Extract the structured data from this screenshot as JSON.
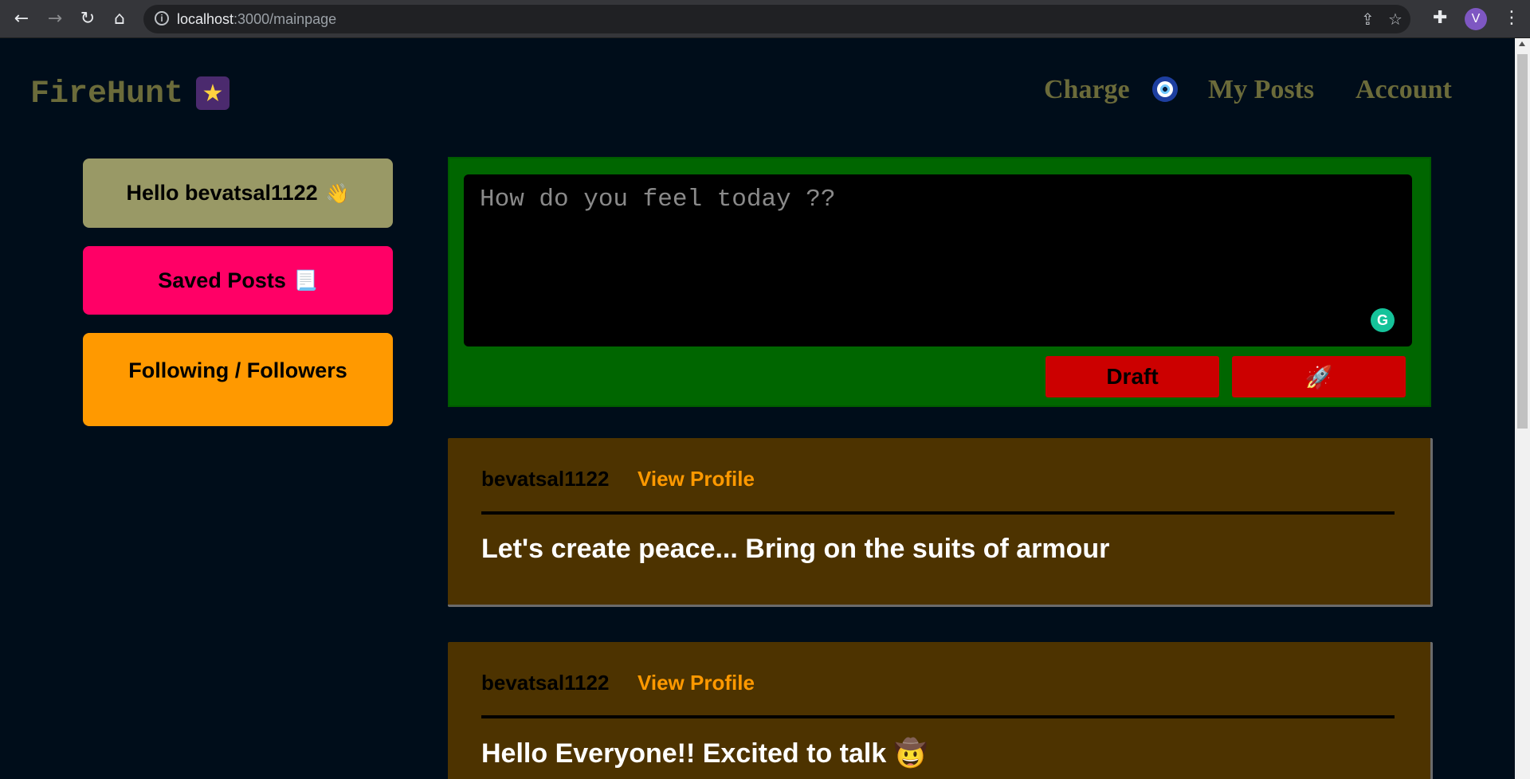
{
  "browser": {
    "url_host": "localhost",
    "url_path": ":3000/mainpage",
    "avatar_letter": "V",
    "icons": [
      "back-icon",
      "forward-icon",
      "reload-icon",
      "home-icon",
      "info-icon",
      "share-icon",
      "star-icon",
      "extensions-icon",
      "menu-icon"
    ]
  },
  "header": {
    "logo": "FireHunt",
    "logo_emoji": "★",
    "nav": {
      "charge": "Charge",
      "my_posts": "My Posts",
      "account": "Account"
    }
  },
  "sidebar": {
    "hello": "Hello bevatsal1122",
    "hello_emoji": "👋",
    "saved": "Saved Posts",
    "saved_emoji": "📃",
    "follow": "Following / Followers",
    "colors": {
      "hello": "#999966",
      "saved": "#ff0066",
      "follow": "#ff9900"
    }
  },
  "composer": {
    "placeholder": "How do you feel today ??",
    "draft_label": "Draft",
    "post_label": "🚀",
    "grammarly": "G"
  },
  "posts": [
    {
      "user": "bevatsal1122",
      "view_profile": "View Profile",
      "body": "Let's create peace... Bring on the suits of armour"
    },
    {
      "user": "bevatsal1122",
      "view_profile": "View Profile",
      "body": "Hello Everyone!! Excited to talk 🤠"
    }
  ]
}
